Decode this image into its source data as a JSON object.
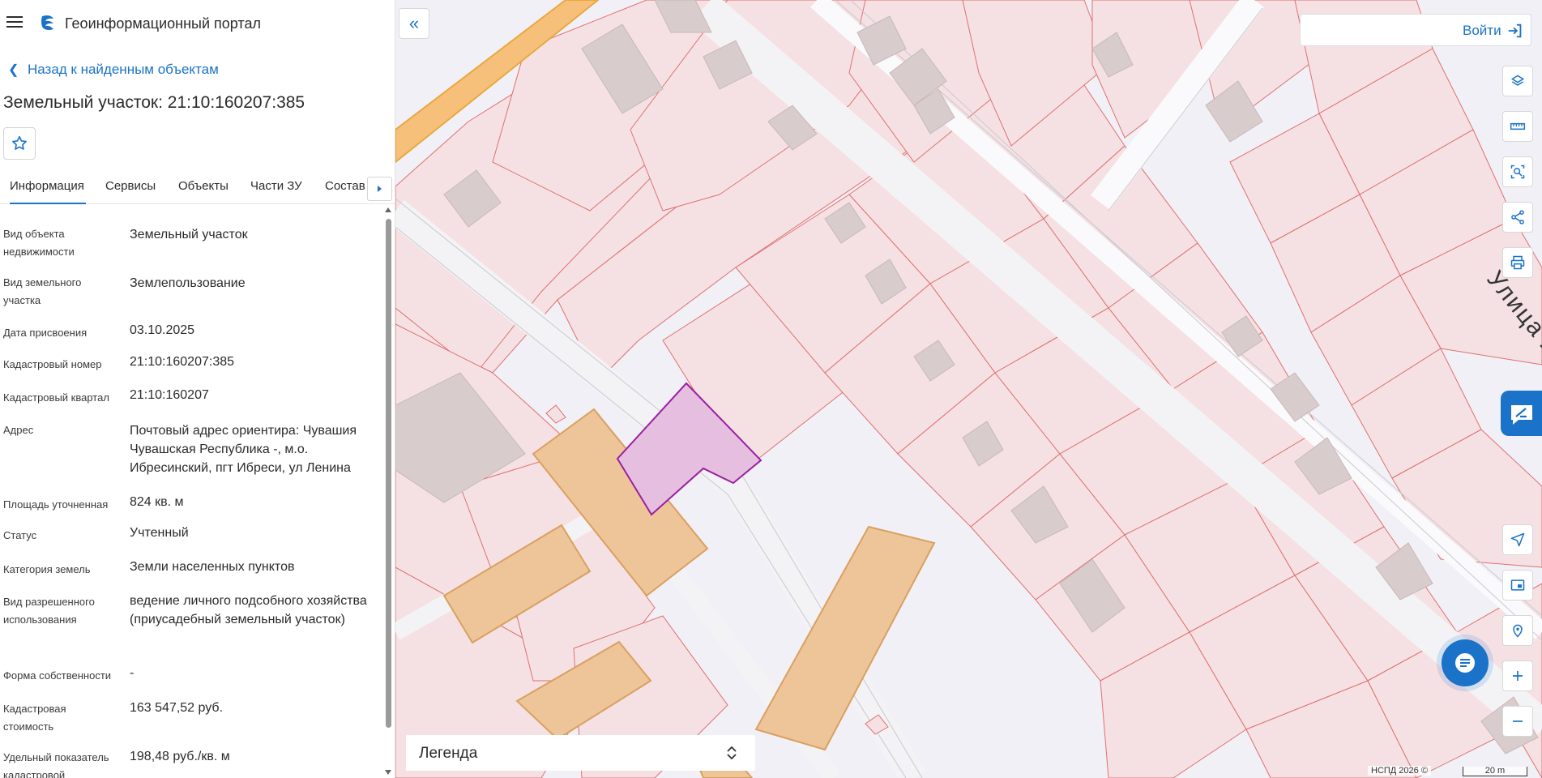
{
  "header": {
    "title": "Геоинформационный портал"
  },
  "nav": {
    "back": "Назад к найденным объектам"
  },
  "object": {
    "title": "Земельный участок: 21:10:160207:385"
  },
  "tabs": [
    {
      "label": "Информация",
      "active": true
    },
    {
      "label": "Сервисы"
    },
    {
      "label": "Объекты"
    },
    {
      "label": "Части ЗУ"
    },
    {
      "label": "Состав"
    }
  ],
  "properties": [
    {
      "label": "Вид объекта недвижимости",
      "value": "Земельный участок"
    },
    {
      "label": "Вид земельного участка",
      "value": "Землепользование"
    },
    {
      "label": "Дата присвоения",
      "value": "03.10.2025"
    },
    {
      "label": "Кадастровый номер",
      "value": "21:10:160207:385"
    },
    {
      "label": "Кадастровый квартал",
      "value": "21:10:160207"
    },
    {
      "label": "Адрес",
      "value": "Почтовый адрес ориентира: Чувашия Чувашская Республика -, м.о. Ибресинский, пгт Ибреси, ул Ленина"
    },
    {
      "label": "Площадь уточненная",
      "value": "824 кв. м"
    },
    {
      "label": "Статус",
      "value": "Учтенный"
    },
    {
      "label": "Категория земель",
      "value": "Земли населенных пунктов"
    },
    {
      "label": "Вид разрешенного использования",
      "value": "ведение личного подсобного хозяйства (приусадебный земельный участок)"
    },
    {
      "label": "Форма собственности",
      "value": "-"
    },
    {
      "label": "Кадастровая стоимость",
      "value": "163 547,52 руб."
    },
    {
      "label": "Удельный показатель кадастровой",
      "value": "198,48 руб./кв. м"
    }
  ],
  "map": {
    "login": "Войти",
    "street": "Улица  Ленина",
    "legend": "Легенда",
    "attribution": "НСПД 2026 ©",
    "scale": "20 m",
    "tools": [
      "layers-icon",
      "ruler-icon",
      "select-area-icon",
      "share-icon",
      "print-icon",
      "locate-icon",
      "minimap-icon",
      "geo-search-icon",
      "zoom-in-icon",
      "zoom-out-icon"
    ]
  },
  "colors": {
    "accent": "#1a73c8",
    "parcel_selected": "#e6bfe0",
    "parcel_selected_stroke": "#9b1fa0",
    "parcel_fill": "#f5e1e3",
    "parcel_stroke": "#e07070",
    "building": "#eec598"
  }
}
